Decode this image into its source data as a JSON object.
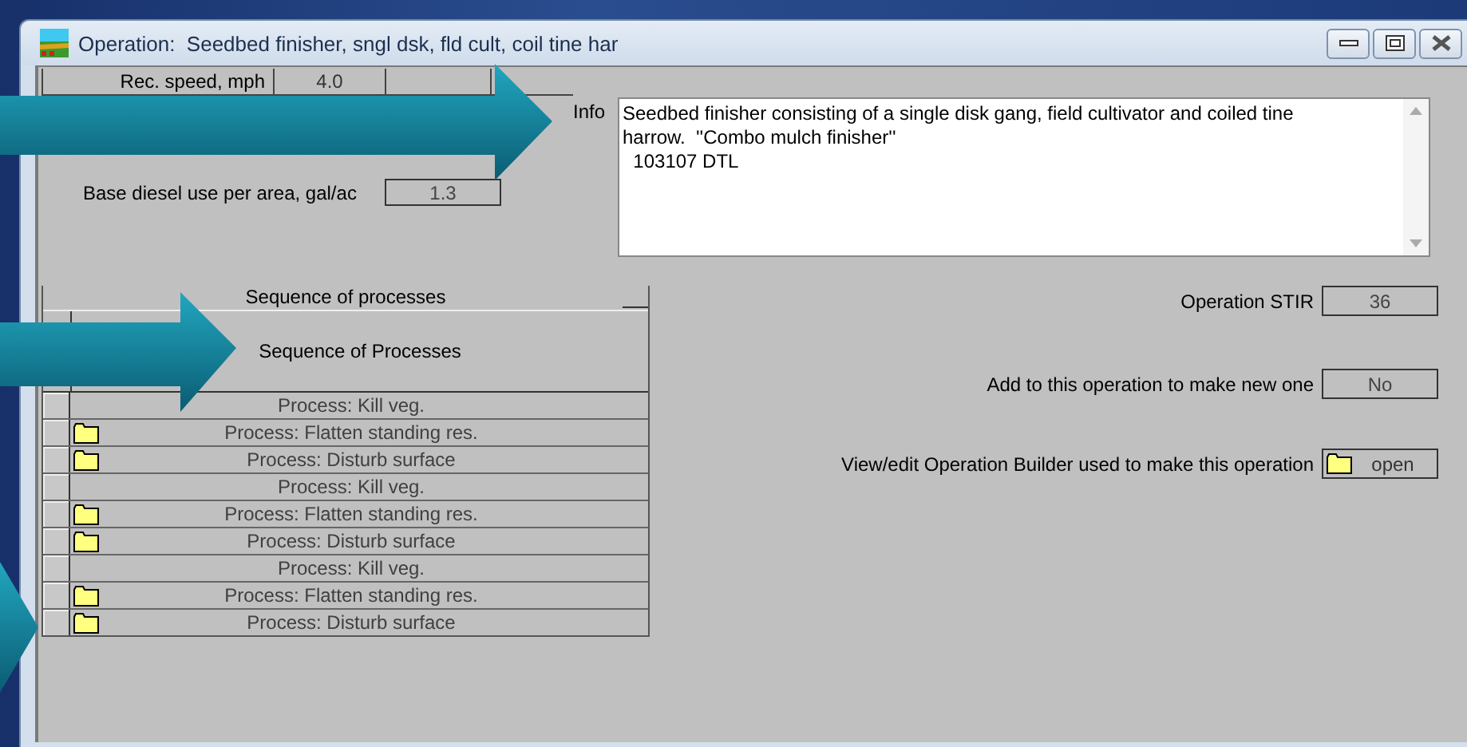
{
  "window": {
    "title": "Operation:  Seedbed finisher, sngl dsk, fld cult, coil tine har"
  },
  "rec_speed": {
    "label": "Rec. speed, mph",
    "value": "4.0"
  },
  "base_diesel": {
    "label": "Base diesel use per area, gal/ac",
    "value": "1.3"
  },
  "info": {
    "label": "Info",
    "lines": [
      "Seedbed finisher consisting of a single disk gang, field cultivator and coiled tine",
      "harrow.  ''Combo mulch finisher''",
      "  103107 DTL"
    ]
  },
  "sequence": {
    "header": "Sequence of processes",
    "title": "Sequence of Processes",
    "rows": [
      {
        "label": "Process: Kill veg.",
        "folder": false
      },
      {
        "label": "Process: Flatten standing res.",
        "folder": true
      },
      {
        "label": "Process: Disturb surface",
        "folder": true
      },
      {
        "label": "Process: Kill veg.",
        "folder": false
      },
      {
        "label": "Process: Flatten standing res.",
        "folder": true
      },
      {
        "label": "Process: Disturb surface",
        "folder": true
      },
      {
        "label": "Process: Kill veg.",
        "folder": false
      },
      {
        "label": "Process: Flatten standing res.",
        "folder": true
      },
      {
        "label": "Process: Disturb surface",
        "folder": true
      }
    ]
  },
  "operation_stir": {
    "label": "Operation STIR",
    "value": "36"
  },
  "add_to_operation": {
    "label": "Add to this operation to make new one",
    "value": "No"
  },
  "operation_builder": {
    "label": "View/edit Operation Builder used to make this operation",
    "button": "open"
  }
}
